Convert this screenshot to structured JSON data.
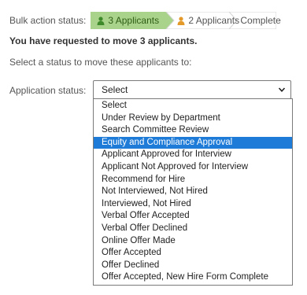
{
  "header": {
    "bulk_label": "Bulk action status:",
    "steps": [
      {
        "label": "3 Applicants",
        "state": "current",
        "icon": "user-icon"
      },
      {
        "label": "2 Applicants",
        "state": "partial",
        "icon": "user-icon"
      },
      {
        "label": "Complete",
        "state": "pending"
      }
    ]
  },
  "message": "You have requested to move 3 applicants.",
  "prompt": "Select a status to move these applicants to:",
  "form": {
    "label": "Application status:",
    "selected": "Select",
    "options": [
      "Select",
      "Under Review by Department",
      "Search Committee Review",
      "Equity and Compliance Approval",
      "Applicant Approved for Interview",
      "Applicant Not Approved for Interview",
      "Recommend for Hire",
      "Not Interviewed, Not Hired",
      "Interviewed, Not Hired",
      "Verbal Offer Accepted",
      "Verbal Offer Declined",
      "Online Offer Made",
      "Offer Accepted",
      "Offer Declined",
      "Offer Accepted, New Hire Form Complete"
    ],
    "highlighted": "Equity and Compliance Approval"
  },
  "colors": {
    "step_current": "#a9d38a",
    "step_partial": "#ffffff",
    "highlight": "#1e7bd8",
    "user_icon_green": "#3e8a2a",
    "user_icon_orange": "#e39a2a"
  }
}
